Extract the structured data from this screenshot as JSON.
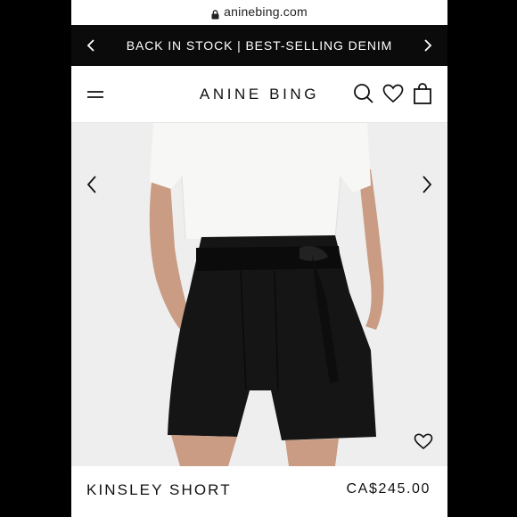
{
  "browser": {
    "url": "aninebing.com"
  },
  "promo": {
    "text": "BACK IN STOCK | BEST-SELLING DENIM"
  },
  "header": {
    "logo": "ANINE BING"
  },
  "product": {
    "name": "KINSLEY SHORT",
    "price": "CA$245.00"
  },
  "icons": [
    "lock-icon",
    "chevron-left-icon",
    "chevron-right-icon",
    "menu-icon",
    "search-icon",
    "heart-icon",
    "bag-icon"
  ],
  "colors": {
    "promo_bg": "#0b0b0b",
    "text": "#111111",
    "image_bg": "#eeeeee"
  }
}
